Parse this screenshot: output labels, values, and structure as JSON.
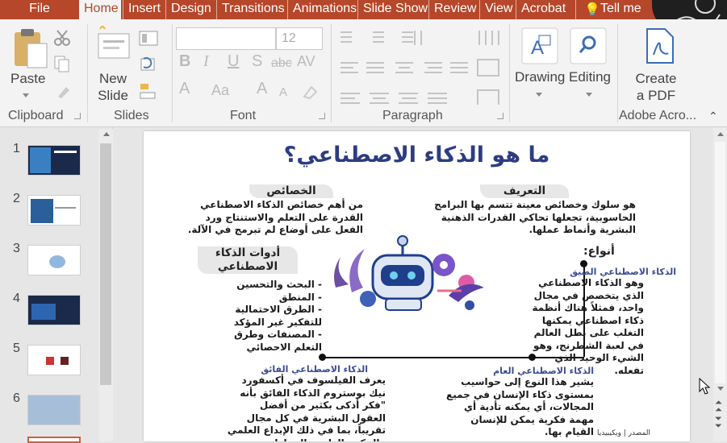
{
  "tabs": [
    "File",
    "Home",
    "Insert",
    "Design",
    "Transitions",
    "Animations",
    "Slide Show",
    "Review",
    "View",
    "Acrobat",
    "Tell me"
  ],
  "ribbon": {
    "clipboard": {
      "paste": "Paste",
      "group": "Clipboard"
    },
    "slides": {
      "new_slide_1": "New",
      "new_slide_2": "Slide",
      "group": "Slides"
    },
    "font": {
      "font_size": "12",
      "bold": "B",
      "italic": "I",
      "underline": "U",
      "shadow": "S",
      "strike": "abc",
      "spacing": "AV",
      "font_color": "A",
      "case": "Aa",
      "group": "Font"
    },
    "paragraph": {
      "group": "Paragraph"
    },
    "drawing": "Drawing",
    "editing": "Editing",
    "acrobat": {
      "create_1": "Create",
      "create_2": "a PDF",
      "group": "Adobe Acro..."
    }
  },
  "thumbnails": [
    "1",
    "2",
    "3",
    "4",
    "5",
    "6"
  ],
  "slide": {
    "title": "ما هو الذكاء الاصطناعي؟",
    "definition_heading": "التعريف",
    "definition_text": "هو سلوك وخصائص معينة تتسم بها البرامج الحاسوبية، تجعلها تحاكي القدرات الذهنية البشرية وأنماط عملها.",
    "features_heading": "الخصائص",
    "features_text": "من أهم خصائص الذكاء الاصطناعي القدرة على التعلم والاستنتاج ورد الفعل على أوضاع لم تبرمج في الآلة.",
    "tools_heading": "أدوات الذكاء الاصطناعي",
    "tools_list": [
      "البحث والتحسين",
      "المنطق",
      "الطرق الاحتمالية للتفكير غير المؤكد",
      "المصنفات وطرق التعلم الاحصائي"
    ],
    "types_heading": "أنواع:",
    "narrow_title": "الذكاء الاصطناعي الضيق",
    "narrow_text": "وهو الذكاء الاصطناعي الذي يتخصص في مجال واحد، فمثلاً هناك أنظمة ذكاء اصطناعي يمكنها التغلب على بطل العالم في لعبة الشطرنج، وهو الشيء الوحيد الذي تفعله.",
    "general_title": "الذكاء الاصطناعي العام",
    "general_text": "يشير هذا النوع إلى حواسيب بمستوى ذكاء الإنسان في جميع المجالات، أي يمكنه تأدية أي مهمة فكرية يمكن للإنسان القيام بها.",
    "super_title": "الذكاء الاصطناعي الفائق",
    "super_text": "يعرف الفيلسوف في أكسفورد نيك بوستروم الذكاء الفائق بأنه \"فكر أذكى بكثير من أفضل العقول البشرية في كل مجال تقريباً، بما في ذلك الإبداع العلمي والحكمة العامة والمهارات الاجتماعية\".",
    "source": "المصدر | ويكيبيديا"
  },
  "colors": {
    "accent": "#b7472a",
    "heading_blue": "#3b4c93",
    "title_blue": "#2d3c82"
  }
}
